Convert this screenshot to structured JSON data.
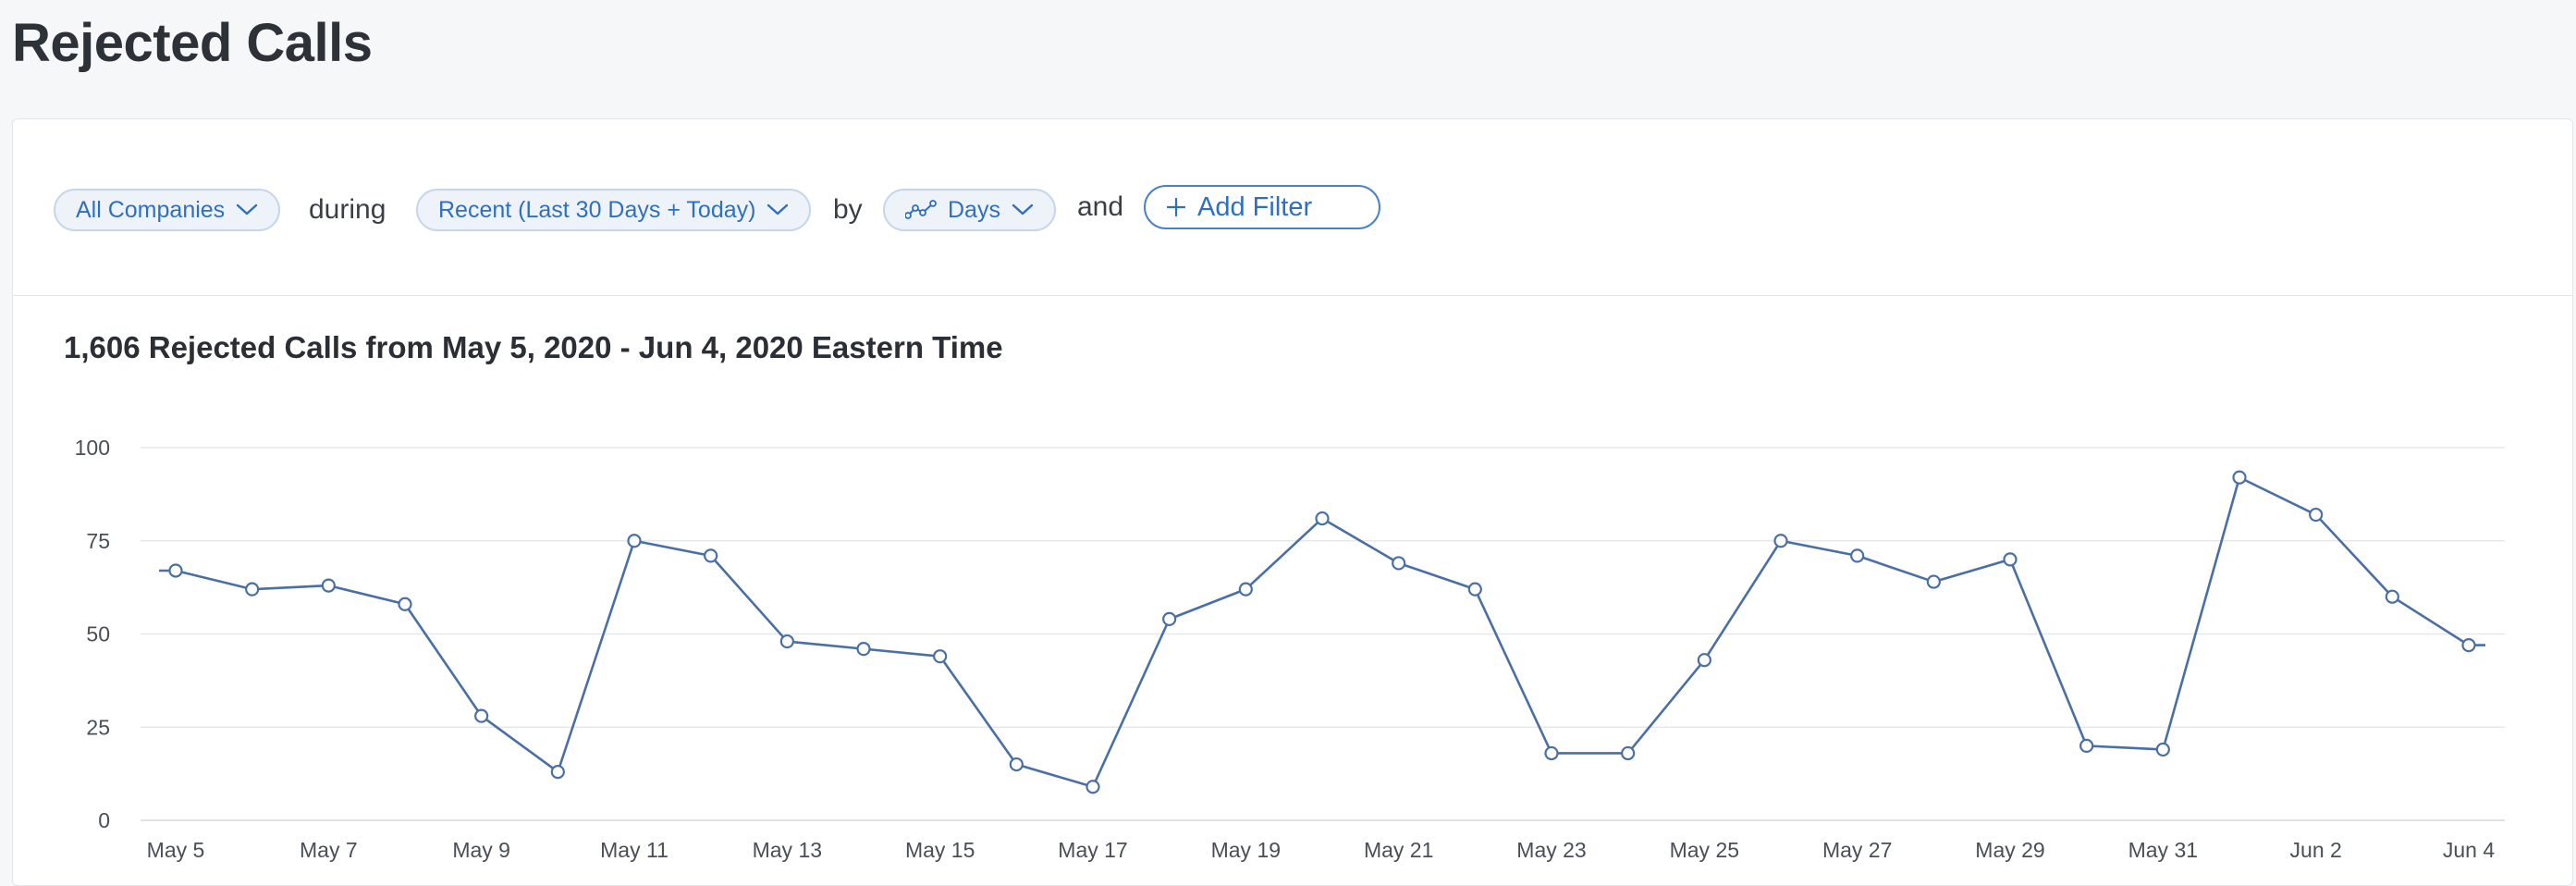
{
  "page": {
    "title": "Rejected Calls"
  },
  "filters": {
    "company": {
      "label": "All Companies",
      "icon": "chevron-down-icon"
    },
    "during_text": "during",
    "range": {
      "label": "Recent (Last 30 Days + Today)",
      "icon": "chevron-down-icon"
    },
    "by_text": "by",
    "granularity": {
      "label": "Days",
      "icon": "line-chart-icon"
    },
    "and_text": "and",
    "add_filter": {
      "label": "Add Filter",
      "icon": "plus-icon"
    }
  },
  "colors": {
    "accent": "#2f6fc0",
    "series": "#4a6fa5",
    "grid": "#e6e8eb"
  },
  "chart_data": {
    "type": "line",
    "title": "1,606 Rejected Calls from May 5, 2020 - Jun 4, 2020 Eastern Time",
    "x": [
      "May 5",
      "May 6",
      "May 7",
      "May 8",
      "May 9",
      "May 10",
      "May 11",
      "May 12",
      "May 13",
      "May 14",
      "May 15",
      "May 16",
      "May 17",
      "May 18",
      "May 19",
      "May 20",
      "May 21",
      "May 22",
      "May 23",
      "May 24",
      "May 25",
      "May 26",
      "May 27",
      "May 28",
      "May 29",
      "May 30",
      "May 31",
      "Jun 1",
      "Jun 2",
      "Jun 3",
      "Jun 4"
    ],
    "tick_labels": [
      "May 5",
      "May 7",
      "May 9",
      "May 11",
      "May 13",
      "May 15",
      "May 17",
      "May 19",
      "May 21",
      "May 23",
      "May 25",
      "May 27",
      "May 29",
      "May 31",
      "Jun 2",
      "Jun 4"
    ],
    "values": [
      67,
      62,
      63,
      58,
      28,
      13,
      75,
      71,
      48,
      46,
      44,
      15,
      9,
      54,
      62,
      81,
      69,
      62,
      18,
      18,
      43,
      75,
      71,
      64,
      70,
      20,
      19,
      92,
      82,
      60,
      47
    ],
    "yticks": [
      0,
      25,
      50,
      75,
      100
    ],
    "ylim": [
      0,
      100
    ],
    "grid": true,
    "legend": "none"
  }
}
